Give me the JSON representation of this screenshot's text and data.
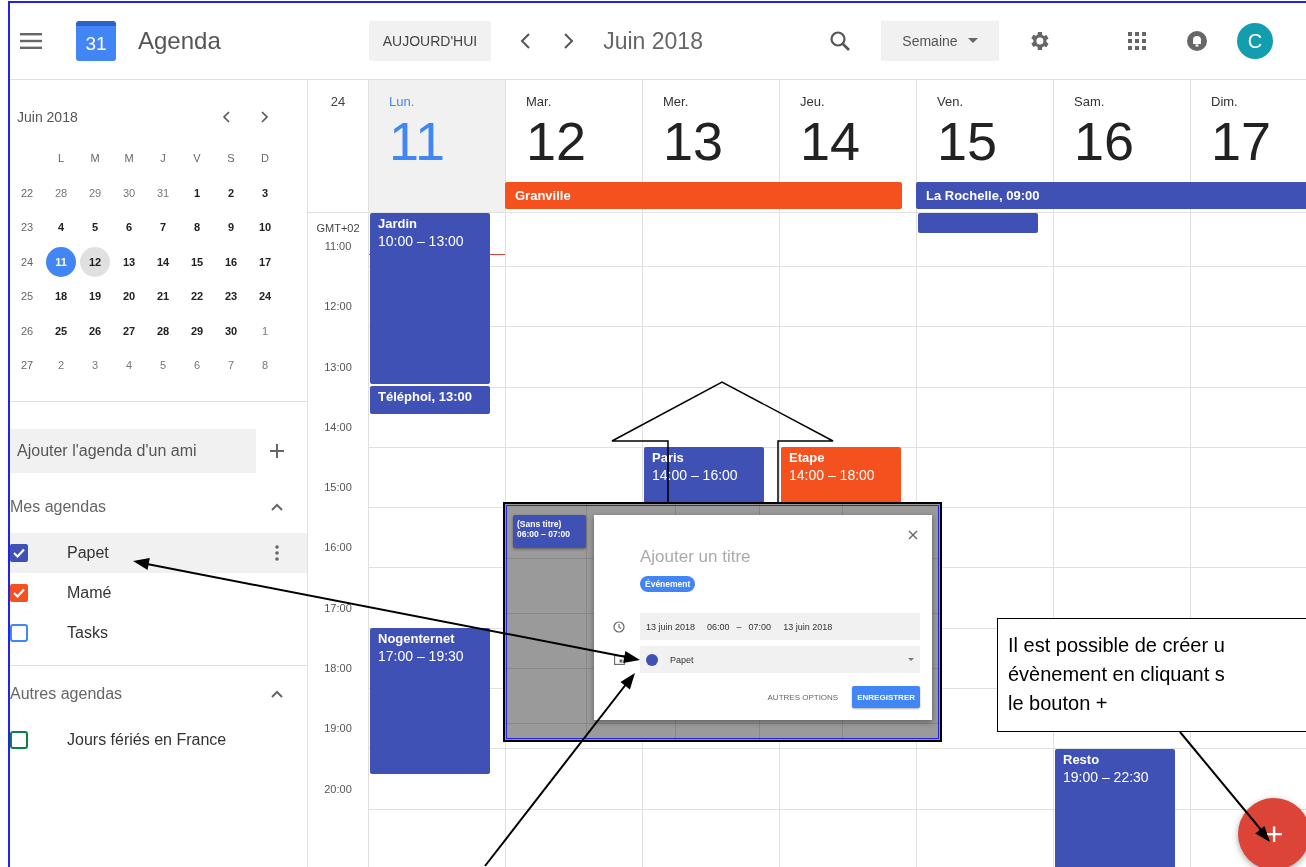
{
  "topbar": {
    "logo_day": "31",
    "app_name": "Agenda",
    "today_button": "AUJOURD'HUI",
    "period": "Juin 2018",
    "view": "Semaine",
    "avatar": "C"
  },
  "sidebar": {
    "mini_calendar": {
      "title": "Juin 2018",
      "weekdays": [
        "L",
        "M",
        "M",
        "J",
        "V",
        "S",
        "D"
      ],
      "weeks": [
        {
          "number": "22",
          "days": [
            {
              "label": "28",
              "kind": "out"
            },
            {
              "label": "29",
              "kind": "out"
            },
            {
              "label": "30",
              "kind": "out"
            },
            {
              "label": "31",
              "kind": "out"
            },
            {
              "label": "1",
              "kind": "in"
            },
            {
              "label": "2",
              "kind": "in"
            },
            {
              "label": "3",
              "kind": "in"
            }
          ]
        },
        {
          "number": "23",
          "days": [
            {
              "label": "4",
              "kind": "in"
            },
            {
              "label": "5",
              "kind": "in"
            },
            {
              "label": "6",
              "kind": "in"
            },
            {
              "label": "7",
              "kind": "in"
            },
            {
              "label": "8",
              "kind": "in"
            },
            {
              "label": "9",
              "kind": "in"
            },
            {
              "label": "10",
              "kind": "in"
            }
          ]
        },
        {
          "number": "24",
          "days": [
            {
              "label": "11",
              "kind": "today"
            },
            {
              "label": "12",
              "kind": "picked"
            },
            {
              "label": "13",
              "kind": "in"
            },
            {
              "label": "14",
              "kind": "in"
            },
            {
              "label": "15",
              "kind": "in"
            },
            {
              "label": "16",
              "kind": "in"
            },
            {
              "label": "17",
              "kind": "in"
            }
          ]
        },
        {
          "number": "25",
          "days": [
            {
              "label": "18",
              "kind": "in"
            },
            {
              "label": "19",
              "kind": "in"
            },
            {
              "label": "20",
              "kind": "in"
            },
            {
              "label": "21",
              "kind": "in"
            },
            {
              "label": "22",
              "kind": "in"
            },
            {
              "label": "23",
              "kind": "in"
            },
            {
              "label": "24",
              "kind": "in"
            }
          ]
        },
        {
          "number": "26",
          "days": [
            {
              "label": "25",
              "kind": "in"
            },
            {
              "label": "26",
              "kind": "in"
            },
            {
              "label": "27",
              "kind": "in"
            },
            {
              "label": "28",
              "kind": "in"
            },
            {
              "label": "29",
              "kind": "in"
            },
            {
              "label": "30",
              "kind": "in"
            },
            {
              "label": "1",
              "kind": "out"
            }
          ]
        },
        {
          "number": "27",
          "days": [
            {
              "label": "2",
              "kind": "out"
            },
            {
              "label": "3",
              "kind": "out"
            },
            {
              "label": "4",
              "kind": "out"
            },
            {
              "label": "5",
              "kind": "out"
            },
            {
              "label": "6",
              "kind": "out"
            },
            {
              "label": "7",
              "kind": "out"
            },
            {
              "label": "8",
              "kind": "out"
            }
          ]
        }
      ]
    },
    "add_friend": {
      "placeholder": "Ajouter l'agenda d'un ami"
    },
    "sections": [
      {
        "title": "Mes agendas",
        "expanded": true,
        "calendars": [
          {
            "name": "Papet",
            "checked": true,
            "selected": true,
            "color": "#3f51b5"
          },
          {
            "name": "Mamé",
            "checked": true,
            "selected": false,
            "color": "#f4511e"
          },
          {
            "name": "Tasks",
            "checked": false,
            "selected": false,
            "color": "#4285f4"
          }
        ]
      },
      {
        "title": "Autres agendas",
        "expanded": true,
        "calendars": [
          {
            "name": "Jours fériés en France",
            "checked": false,
            "selected": false,
            "color": "#0b8043"
          }
        ]
      }
    ]
  },
  "week": {
    "week_number": "24",
    "timezone": "GMT+02",
    "hours": [
      "11:00",
      "12:00",
      "13:00",
      "14:00",
      "15:00",
      "16:00",
      "17:00",
      "18:00",
      "19:00",
      "20:00"
    ],
    "all_day": [
      {
        "title": "Granville",
        "color": "#f4511e"
      },
      {
        "title": "La Rochelle, 09:00",
        "color": "#3f51b5"
      }
    ],
    "days": [
      {
        "name": "Lun.",
        "date": "11",
        "today": true,
        "events": [
          {
            "title": "Jardin",
            "time": "10:00 – 13:00",
            "color": "#3f51b5"
          },
          {
            "title": "Téléphoi, 13:00",
            "color": "#3f51b5"
          },
          {
            "title": "Nogenternet",
            "time": "17:00 – 19:30",
            "color": "#3f51b5"
          }
        ]
      },
      {
        "name": "Mar.",
        "date": "12",
        "today": false
      },
      {
        "name": "Mer.",
        "date": "13",
        "today": false,
        "events": [
          {
            "title": "Paris",
            "time": "14:00 – 16:00",
            "color": "#3f51b5"
          }
        ]
      },
      {
        "name": "Jeu.",
        "date": "14",
        "today": false,
        "events": [
          {
            "title": "Etape",
            "time": "14:00 – 18:00",
            "color": "#f4511e"
          }
        ]
      },
      {
        "name": "Ven.",
        "date": "15",
        "today": false,
        "events": [
          {
            "color": "#3f51b5"
          }
        ]
      },
      {
        "name": "Sam.",
        "date": "16",
        "today": false,
        "events": [
          {
            "title": "Resto",
            "time": "19:00 – 22:30",
            "color": "#3f51b5"
          }
        ]
      },
      {
        "name": "Dim.",
        "date": "17",
        "today": false
      }
    ]
  },
  "popup": {
    "draft_event": {
      "title": "(Sans titre)",
      "time": "06:00 – 07:00",
      "color": "#3f51b5"
    },
    "title_placeholder": "Ajouter un titre",
    "type_chip": "Événement",
    "start_date": "13 juin 2018",
    "start_time": "06:00",
    "separator": "–",
    "end_time": "07:00",
    "end_date": "13 juin 2018",
    "calendar": {
      "name": "Papet",
      "color": "#3f51b5"
    },
    "more_button": "AUTRES OPTIONS",
    "save_button": "ENREGISTRER"
  },
  "callout": {
    "lines": [
      "Il est possible de créer u",
      "évènement en cliquant s",
      "le bouton +"
    ]
  },
  "fab": {
    "label": "+"
  }
}
